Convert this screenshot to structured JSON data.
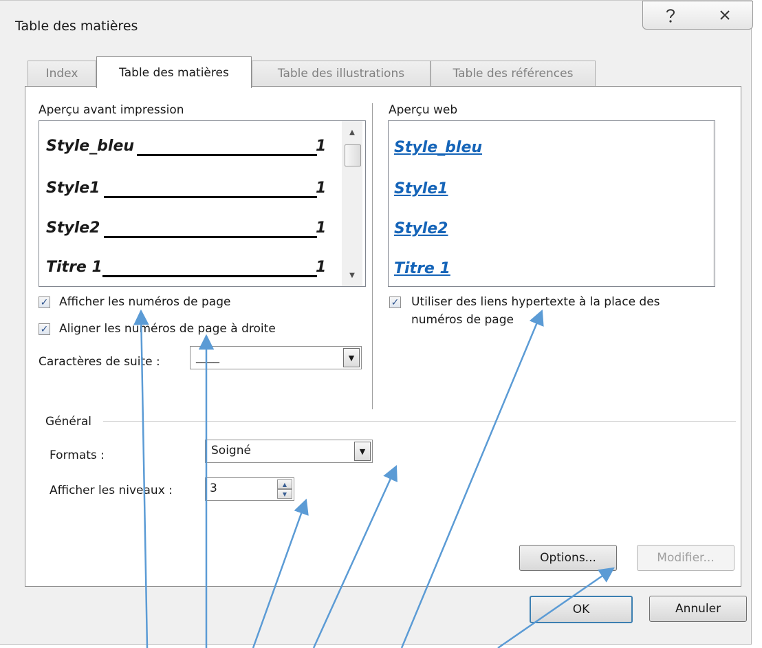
{
  "dialog": {
    "title": "Table des matières"
  },
  "title_buttons": {
    "help_icon": "?",
    "close_icon": "✕"
  },
  "tabs": [
    {
      "label": "Index",
      "active": false
    },
    {
      "label": "Table des matières",
      "active": true
    },
    {
      "label": "Table des illustrations",
      "active": false
    },
    {
      "label": "Table des références",
      "active": false
    }
  ],
  "print_preview": {
    "label": "Aperçu avant impression",
    "entries": [
      {
        "text": "Style_bleu",
        "page": "1"
      },
      {
        "text": "Style1",
        "page": "1"
      },
      {
        "text": "Style2",
        "page": "1"
      },
      {
        "text": "Titre 1",
        "page": "1"
      }
    ]
  },
  "web_preview": {
    "label": "Aperçu web",
    "entries": [
      "Style_bleu",
      "Style1",
      "Style2",
      "Titre 1"
    ],
    "link_color": "#1564b8"
  },
  "options": {
    "show_page_numbers": {
      "label": "Afficher les numéros de page",
      "checked": true
    },
    "right_align_numbers": {
      "label": "Aligner les numéros de page à droite",
      "checked": true
    },
    "use_hyperlinks": {
      "label_line1": "Utiliser des liens hypertexte à la place des",
      "label_line2": "numéros de page",
      "checked": true
    },
    "tab_leader": {
      "label": "Caractères de suite :",
      "value": "____"
    }
  },
  "general": {
    "title": "Général",
    "formats": {
      "label": "Formats :",
      "value": "Soigné"
    },
    "levels": {
      "label": "Afficher les niveaux :",
      "value": "3"
    }
  },
  "buttons": {
    "options": "Options...",
    "modify": "Modifier...",
    "ok": "OK",
    "cancel": "Annuler"
  },
  "annotation_color": "#5b9bd5"
}
